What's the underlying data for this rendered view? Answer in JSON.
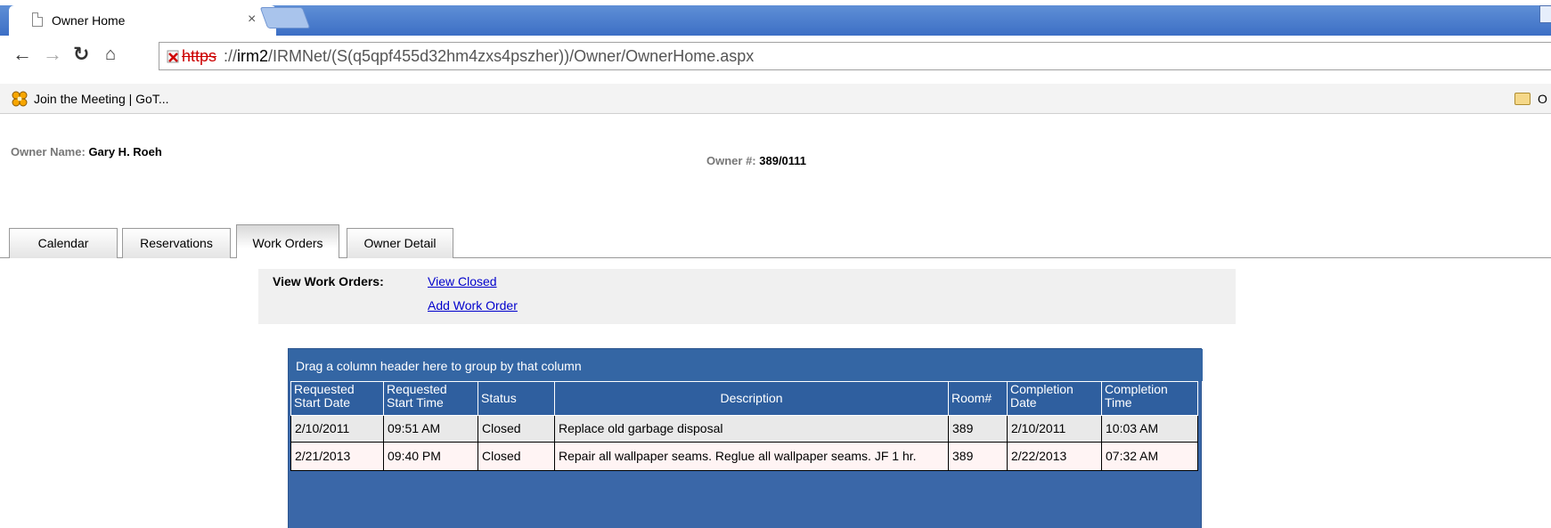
{
  "browser": {
    "tab_title": "Owner Home",
    "tab_close": "×",
    "url_scheme": "https",
    "url_host": "irm2",
    "url_path": "://irm2/IRMNet/(S(q5qpf455d32hm4zxs4pszher))/Owner/OwnerHome.aspx",
    "bookmarks": [
      {
        "label": "Join the Meeting | GoT...",
        "icon": "gotomeeting-icon"
      },
      {
        "label": "O",
        "icon": "folder-icon"
      }
    ]
  },
  "owner": {
    "name_label": "Owner Name:",
    "name_value": "Gary H. Roeh",
    "number_label": "Owner #:",
    "number_value": "389/0111"
  },
  "tabs": [
    {
      "label": "Calendar",
      "active": false
    },
    {
      "label": "Reservations",
      "active": false
    },
    {
      "label": "Work Orders",
      "active": true
    },
    {
      "label": "Owner Detail",
      "active": false
    }
  ],
  "work_orders": {
    "label": "View Work Orders:",
    "view_closed": "View Closed",
    "add_work_order": "Add Work Order"
  },
  "grid": {
    "group_prompt": "Drag a column header here to group by that column",
    "columns": [
      "Requested Start Date",
      "Requested Start Time",
      "Status",
      "Description",
      "Room#",
      "Completion Date",
      "Completion Time"
    ],
    "rows": [
      [
        "2/10/2011",
        "09:51 AM",
        "Closed",
        "Replace old garbage disposal",
        "389",
        "2/10/2011",
        "10:03 AM"
      ],
      [
        "2/21/2013",
        "09:40 PM",
        "Closed",
        "Repair all wallpaper seams. Reglue all wallpaper seams. JF 1 hr.",
        "389",
        "2/22/2013",
        "07:32 AM"
      ]
    ]
  },
  "colors": {
    "tabstrip": "#3c6fc5",
    "grid_header": "#2f5f9f",
    "link": "#0000cc",
    "panel": "#f0f0f0"
  }
}
